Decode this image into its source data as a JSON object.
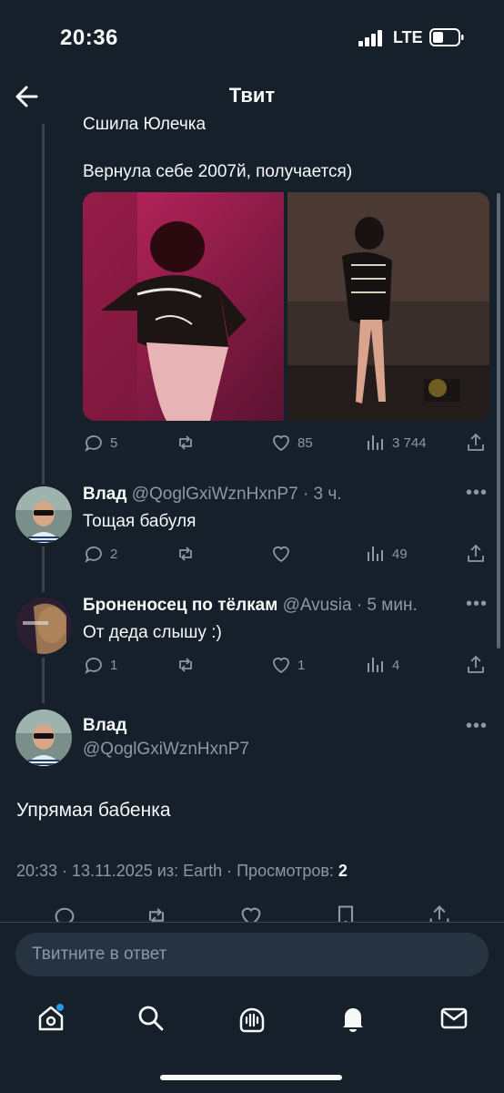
{
  "status": {
    "time": "20:36",
    "network": "LTE"
  },
  "header": {
    "title": "Твит"
  },
  "thread": {
    "partial_line": "Сшила Юлечка",
    "text": "Вернула себе 2007й, получается)",
    "stats": {
      "replies": "5",
      "likes": "85",
      "views": "3 744"
    }
  },
  "replies": [
    {
      "name": "Влад",
      "handle": "@QoglGxiWznHxnP7",
      "time": "· 3 ч.",
      "text": "Тощая бабуля",
      "stats": {
        "replies": "2",
        "reposts": "",
        "likes": "",
        "views": "49"
      }
    },
    {
      "name": "Броненосец по тёлкам",
      "handle": "@Avusia",
      "time": "· 5 мин.",
      "text": "От деда слышу :)",
      "stats": {
        "replies": "1",
        "reposts": "",
        "likes": "1",
        "views": "4"
      }
    }
  ],
  "main_tweet": {
    "name": "Влад",
    "handle": "@QoglGxiWznHxnP7",
    "text": "Упрямая бабенка",
    "meta_prefix": "20:33 · 13.11.2025 из: Earth · Просмотров: ",
    "meta_views": "2"
  },
  "reply_input": {
    "placeholder": "Твитните в ответ"
  },
  "tabbar": [
    "home-icon",
    "search-icon",
    "spaces-icon",
    "notifications-icon",
    "messages-icon"
  ],
  "colors": {
    "background": "#15202b",
    "muted": "#8b98a5",
    "accent": "#1d9bf0"
  }
}
